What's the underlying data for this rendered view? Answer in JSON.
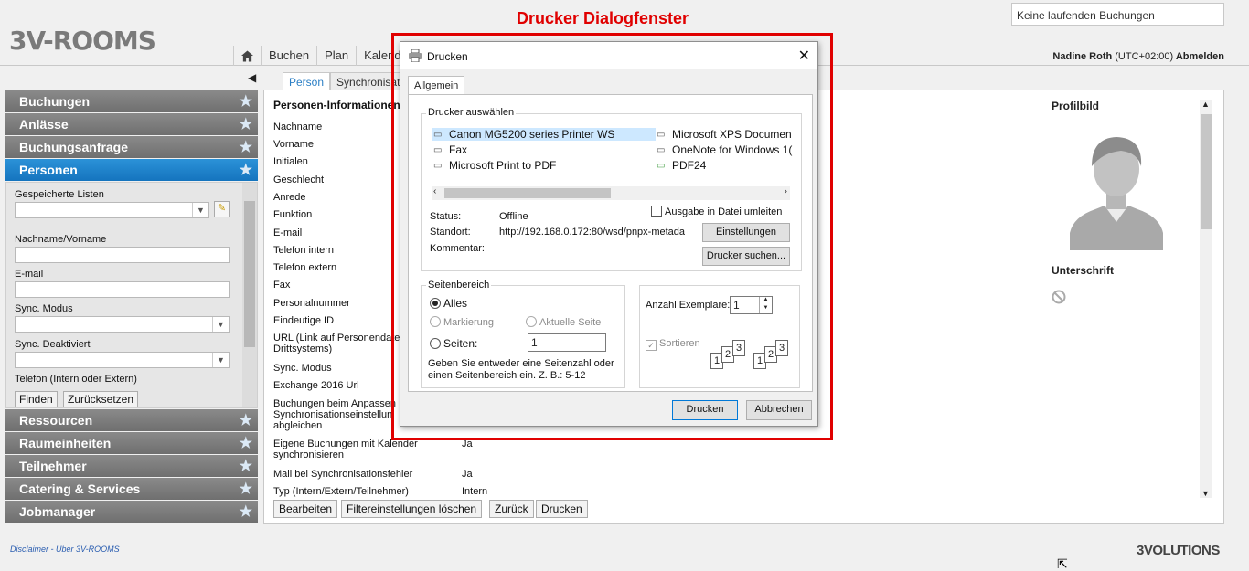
{
  "app": {
    "logo": "3V-ROOMS",
    "booking_status": "Keine laufenden Buchungen",
    "user": "Nadine Roth",
    "timezone": "(UTC+02:00)",
    "logout": "Abmelden"
  },
  "annotation": {
    "title": "Drucker Dialogfenster",
    "color": "#e00000"
  },
  "nav": {
    "items": [
      "Buchen",
      "Plan",
      "Kalend"
    ]
  },
  "sidebar": {
    "sections_top": [
      "Buchungen",
      "Anlässe",
      "Buchungsanfrage"
    ],
    "active": "Personen",
    "sections_bottom": [
      "Ressourcen",
      "Raumeinheiten",
      "Teilnehmer",
      "Catering & Services",
      "Jobmanager"
    ],
    "saved_lists_label": "Gespeicherte Listen",
    "filters": [
      "Nachname/Vorname",
      "E-mail",
      "Sync. Modus",
      "Sync. Deaktiviert",
      "Telefon (Intern oder Extern)"
    ],
    "find_button": "Finden",
    "reset_button": "Zurücksetzen"
  },
  "tabs": [
    "Person",
    "Synchronisat"
  ],
  "person": {
    "section_title": "Personen-Informationen",
    "fields": [
      "Nachname",
      "Vorname",
      "Initialen",
      "Geschlecht",
      "Anrede",
      "Funktion",
      "E-mail",
      "Telefon intern",
      "Telefon extern",
      "Fax",
      "Personalnummer",
      "Eindeutige ID",
      "URL (Link auf Personendate\nDrittsystems)",
      "Sync. Modus",
      "Exchange 2016 Url",
      "Buchungen beim Anpassen\nSynchronisationseinstellun\nabgleichen",
      "Eigene Buchungen mit Kalender\nsynchronisieren",
      "Mail bei Synchronisationsfehler",
      "Typ (Intern/Extern/Teilnehmer)"
    ],
    "values": {
      "eigene_buchungen": "Ja",
      "mail_fehler": "Ja",
      "typ": "Intern"
    },
    "profile_picture_label": "Profilbild",
    "signature_label": "Unterschrift",
    "buttons": [
      "Bearbeiten",
      "Filtereinstellungen löschen",
      "Zurück",
      "Drucken"
    ]
  },
  "dialog": {
    "title": "Drucken",
    "tab": "Allgemein",
    "select_printer": "Drucker auswählen",
    "printers_col1": [
      "Canon MG5200 series Printer WS",
      "Fax",
      "Microsoft Print to PDF"
    ],
    "printers_col2": [
      "Microsoft XPS Documen",
      "OneNote for Windows 1(",
      "PDF24"
    ],
    "selected_printer": "Canon MG5200 series Printer WS",
    "print_to_file": "Ausgabe in Datei umleiten",
    "status_label": "Status:",
    "status_value": "Offline",
    "location_label": "Standort:",
    "location_value": "http://192.168.0.172:80/wsd/pnpx-metada",
    "comment_label": "Kommentar:",
    "settings_button": "Einstellungen",
    "find_printer_button": "Drucker suchen...",
    "page_range": "Seitenbereich",
    "all": "Alles",
    "selection": "Markierung",
    "current_page": "Aktuelle Seite",
    "pages": "Seiten:",
    "pages_value": "1",
    "hint": "Geben Sie entweder eine Seitenzahl oder\neinen Seitenbereich ein. Z. B.: 5-12",
    "copies_label": "Anzahl Exemplare:",
    "copies_value": "1",
    "collate": "Sortieren",
    "print_button": "Drucken",
    "cancel_button": "Abbrechen"
  },
  "footer": {
    "links": "Disclaimer  -  Über 3V-ROOMS",
    "brand": "3VOLUTIONS"
  }
}
